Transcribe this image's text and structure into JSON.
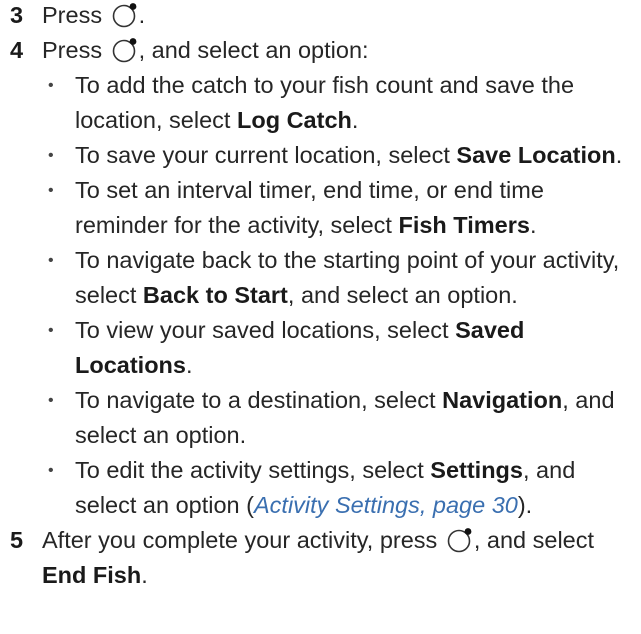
{
  "steps": [
    {
      "num": "3",
      "pre": "Press",
      "post": "."
    },
    {
      "num": "4",
      "pre": "Press",
      "post": ", and select an option:"
    },
    {
      "num": "5",
      "pre": "After you complete your activity, press",
      "post": ", and select",
      "bold": "End Fish",
      "end": "."
    }
  ],
  "bullets": [
    {
      "pre": "To add the catch to your fish count and save the location, select ",
      "bold": "Log Catch",
      "post": "."
    },
    {
      "pre": "To save your current location, select ",
      "bold": "Save Location",
      "post": "."
    },
    {
      "pre": "To set an interval timer, end time, or end time reminder for the activity, select ",
      "bold": "Fish Timers",
      "post": "."
    },
    {
      "pre": "To navigate back to the starting point of your activity, select ",
      "bold": "Back to Start",
      "post": ", and select an option."
    },
    {
      "pre": "To view your saved locations, select ",
      "bold": "Saved Locations",
      "post": "."
    },
    {
      "pre": "To navigate to a destination, select ",
      "bold": "Navigation",
      "post": ", and select an option."
    },
    {
      "pre": "To edit the activity settings, select ",
      "bold": "Settings",
      "post": ", and select an option (",
      "link": "Activity Settings, page 30",
      "end": ")."
    }
  ],
  "bullet_glyph": "•",
  "icon": "watch-button-icon"
}
